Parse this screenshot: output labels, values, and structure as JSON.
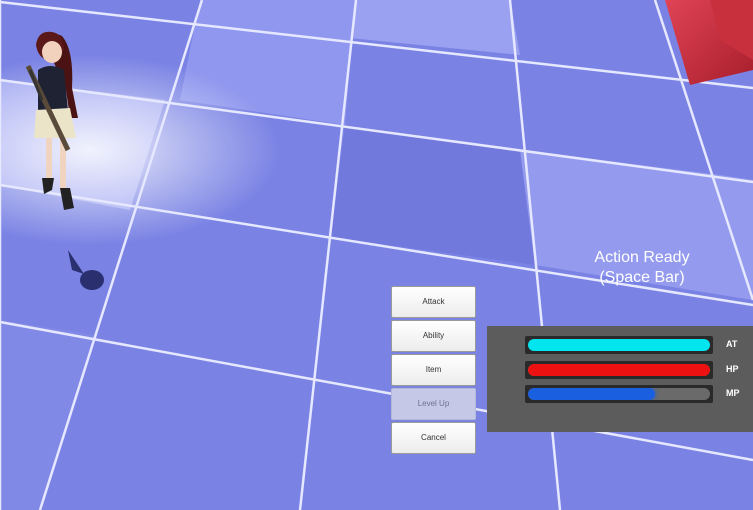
{
  "hud": {
    "prompt_line1": "Action Ready",
    "prompt_line2": "(Space Bar)"
  },
  "action_menu": {
    "attack_label": "Attack",
    "ability_label": "Ability",
    "item_label": "Item",
    "level_up_label": "Level Up",
    "cancel_label": "Cancel"
  },
  "status_panel": {
    "bars": [
      {
        "label": "AT",
        "fraction": 1.0,
        "color": "#00e5ee"
      },
      {
        "label": "HP",
        "fraction": 1.0,
        "color": "#ee1111"
      },
      {
        "label": "MP",
        "fraction": 0.7,
        "color": "#1a5fe0"
      }
    ]
  }
}
